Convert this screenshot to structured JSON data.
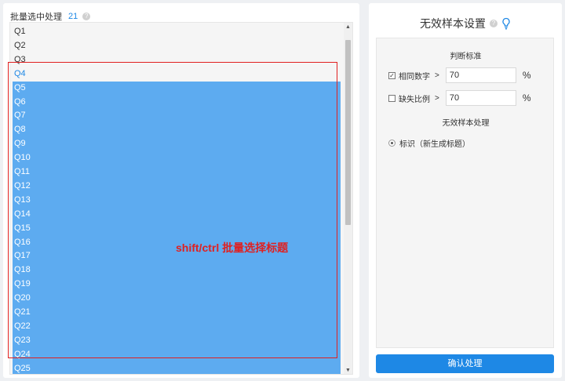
{
  "left": {
    "header_label": "批量选中处理",
    "selected_count": "21",
    "items_plain": [
      "Q1",
      "Q2",
      "Q3"
    ],
    "item_active": "Q4",
    "items_selected": [
      "Q5",
      "Q6",
      "Q7",
      "Q8",
      "Q9",
      "Q10",
      "Q11",
      "Q12",
      "Q13",
      "Q14",
      "Q15",
      "Q16",
      "Q17",
      "Q18",
      "Q19",
      "Q20",
      "Q21",
      "Q22",
      "Q23",
      "Q24",
      "Q25"
    ],
    "annotation": "shift/ctrl 批量选择标题",
    "scroll_up_icon": "▲",
    "scroll_down_icon": "▼",
    "help_icon": "?"
  },
  "right": {
    "title": "无效样本设置",
    "help_icon": "?",
    "criteria_title": "判断标准",
    "criteria": [
      {
        "label": "相同数字",
        "checked": true,
        "op": ">",
        "value": "70",
        "unit": "%"
      },
      {
        "label": "缺失比例",
        "checked": false,
        "op": ">",
        "value": "70",
        "unit": "%"
      }
    ],
    "process_title": "无效样本处理",
    "radio_label": "标识（新生成标题）",
    "confirm_label": "确认处理"
  },
  "colors": {
    "accent": "#1e88e5",
    "selection": "#5dabf0",
    "annotation": "#e02020"
  }
}
